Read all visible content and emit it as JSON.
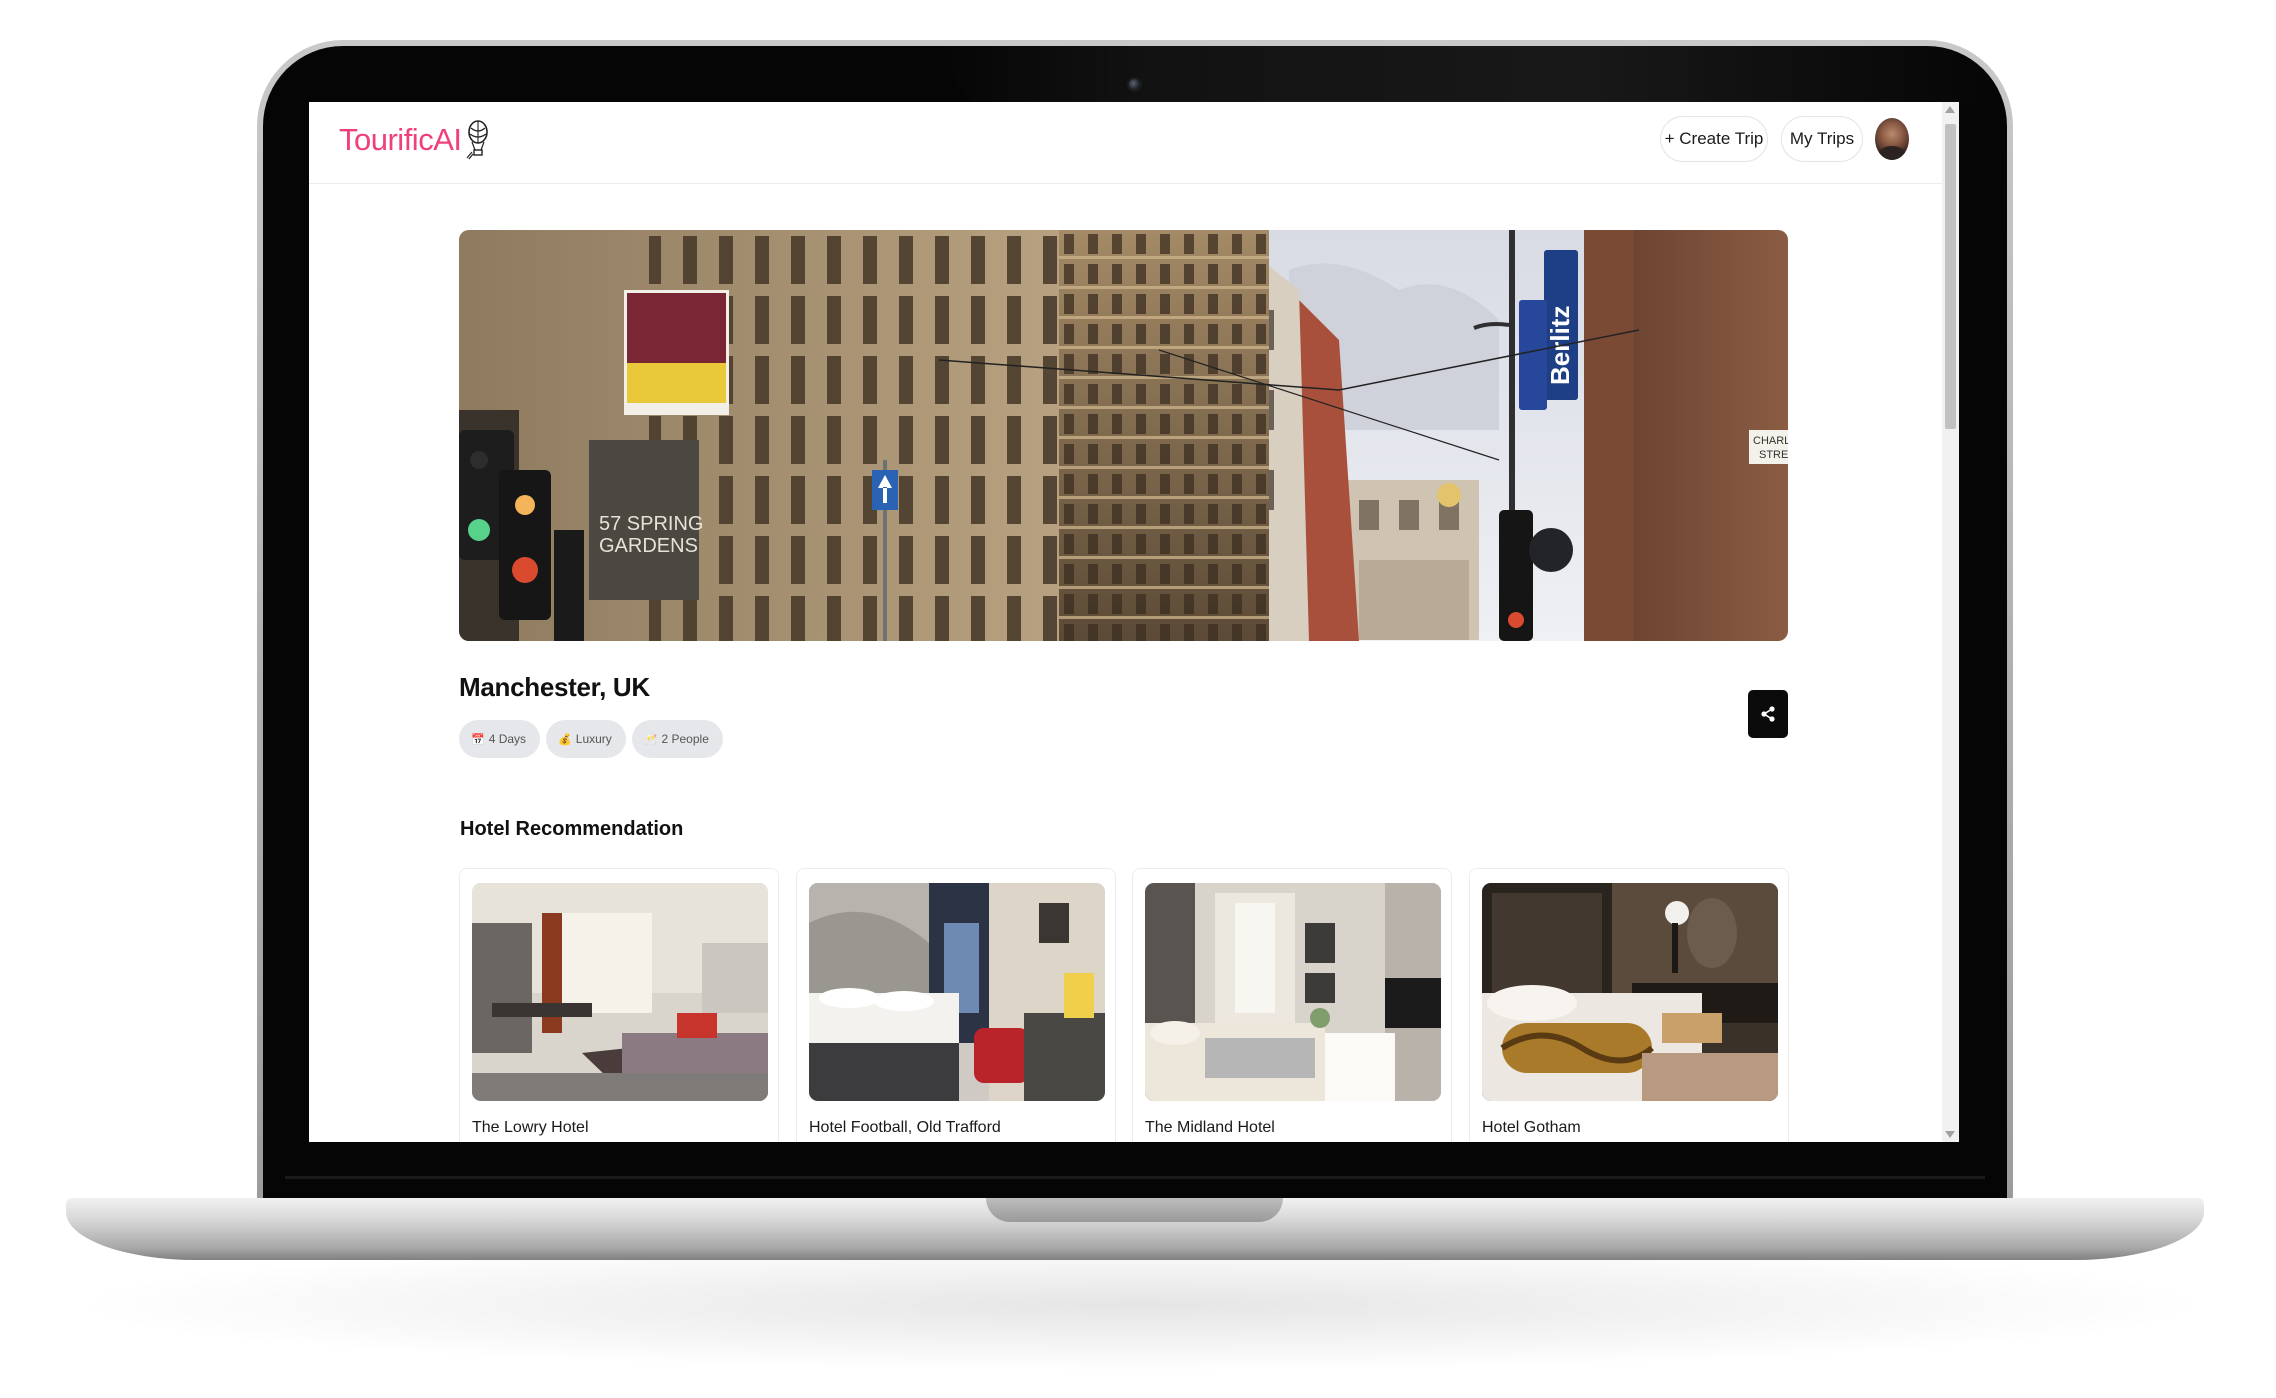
{
  "brand": {
    "name": "TourificAI",
    "accent": "#f0407a"
  },
  "header": {
    "create_trip_label": "+ Create Trip",
    "my_trips_label": "My Trips"
  },
  "trip": {
    "title": "Manchester, UK",
    "pills": [
      {
        "icon": "calendar-icon",
        "label": "4 Days"
      },
      {
        "icon": "money-bag-icon",
        "label": "Luxury"
      },
      {
        "icon": "people-icon",
        "label": "2 People"
      }
    ]
  },
  "hero_sign": {
    "spring_label": "57 SPRING\nGARDENS",
    "berlitz": "Berlitz",
    "street": "CHARLO\nSTREE"
  },
  "hotels_section": {
    "title": "Hotel Recommendation",
    "hotels": [
      {
        "name": "The Lowry Hotel"
      },
      {
        "name": "Hotel Football, Old Trafford"
      },
      {
        "name": "The Midland Hotel"
      },
      {
        "name": "Hotel Gotham"
      }
    ]
  }
}
